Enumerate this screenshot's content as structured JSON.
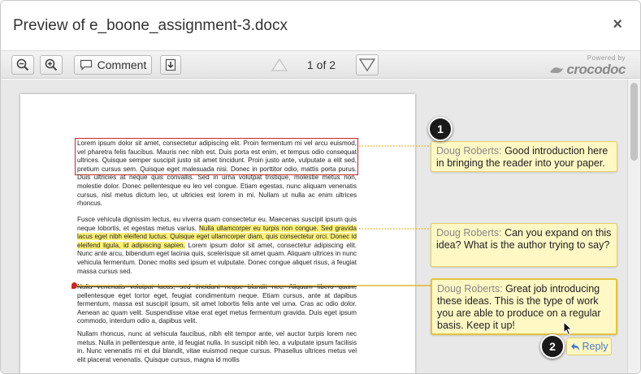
{
  "dialog": {
    "title": "Preview of e_boone_assignment-3.docx",
    "close_glyph": "×"
  },
  "toolbar": {
    "zoom_out_icon": "zoom-out-icon",
    "zoom_in_icon": "zoom-in-icon",
    "comment_label": "Comment",
    "download_icon": "download-icon",
    "page_indicator": "1 of 2",
    "powered_by": "Powered by",
    "brand": "crocodoc"
  },
  "document": {
    "paragraphs": [
      {
        "highlight_text": "",
        "text": "Lorem ipsum dolor sit amet, consectetur adipiscing elit. Proin fermentum mi vel arcu euismod, vel pharetra felis faucibus. Mauris nec nibh est. Duis porta est enim, et tempus odio consequat ultrices. Quisque semper suscipit justo sit amet tincidunt. Proin justo ante, vulputate a elit sed, pretium cursus sem. Quisque eget malesuada nisi. Donec in porttitor odio, mattis porta purus. Duis ultricies at neque quis convallis. Sed in urna volutpat tristique, molestie metus non, molestie dolor. Donec pellentesque eu leo vel congue. Etiam egestas, nunc aliquam venenatis cursus, nisl metus dictum leo, ut ultricies est lorem in mi. Nullam ut nulla ac enim ultrices rhoncus."
      },
      {
        "before": "Fusce vehicula dignissim lectus, eu viverra quam consectetur eu. Maecenas suscipit ipsum quis neque lobortis, et egestas metus varius. ",
        "highlight": "Nulla ullamcorper eu turpis non congue. Sed gravida lacus eget nibh eleifend luctus. Quisque eget ullamcorper diam, quis consectetur orci. Donec id eleifend ligula, id adipiscing sapien.",
        "after": " Lorem ipsum dolor sit amet, consectetur adipiscing elit. Nunc ante arcu, bibendum eget lacinia quis, scelerisque sit amet quam. Aliquam ultrices in nunc vehicula fermentum. Donec mollis sed ipsum et vulputate. Donec congue aliquet risus, a feugiat massa cursus sed."
      },
      {
        "strike": "Nulla venenatis volutpat lacus, sed tincidunt neque blandit nec. Aliquam libero quam,",
        "after": " pellentesque eget tortor eget, feugiat condimentum neque. Etiam cursus, ante at dapibus fermentum, massa est suscipit ipsum, sit amet lobortis felis ante vel urna. Cras ac odio dolor. Aenean ac quam velit. Suspendisse vitae erat eget metus fermentum gravida. Duis eget ipsum commodo, interdum odio a, dapibus velit."
      },
      {
        "text": "Nullam rhoncus, nunc at vehicula faucibus, nibh elit tempor ante, vel auctor turpis lorem nec metus. Nulla in pellentesque ante, id feugiat nulla. In suscipit nibh leo, a vulputate ipsum facilisis in. Nunc venenatis mi et dui blandit, vitae euismod neque cursus. Phasellus ultrices metus vel elit placerat venenatis. Quisque cursus, magna id mollis"
      }
    ]
  },
  "comments": [
    {
      "author": "Doug Roberts:",
      "text": " Good introduction here in bringing the reader into your paper."
    },
    {
      "author": "Doug Roberts:",
      "text": " Can you expand on this idea? What is the author trying to say?"
    },
    {
      "author": "Doug Roberts:",
      "text": " Great job introducing these ideas. This is the type of work you are able to produce on a regular basis. Keep it up!"
    }
  ],
  "reply_label": "Reply",
  "badges": [
    "1",
    "2"
  ],
  "colors": {
    "highlight": "#fff176",
    "comment_bg": "#fff8c4",
    "annotation_red": "#c62828",
    "connector_yellow": "#e5b62a",
    "reply_blue": "#4a7cc4"
  }
}
